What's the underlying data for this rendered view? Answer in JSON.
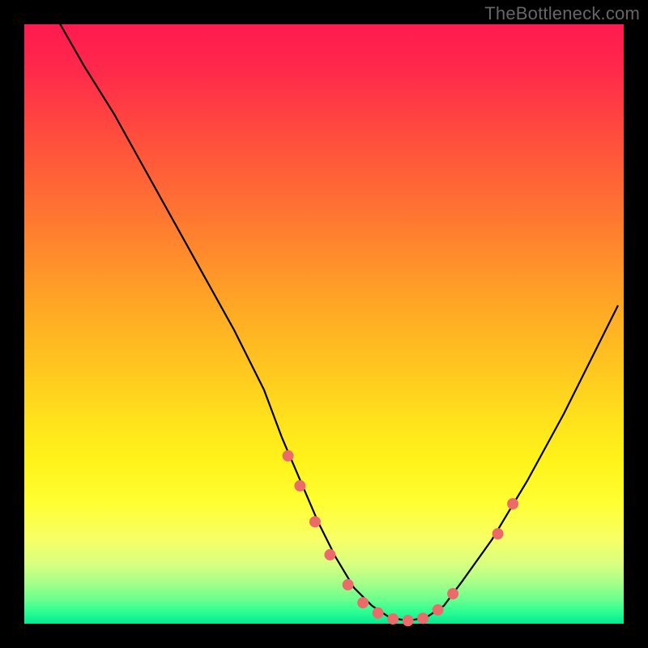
{
  "watermark": "TheBottleneck.com",
  "chart_data": {
    "type": "line",
    "title": "",
    "xlabel": "",
    "ylabel": "",
    "xlim": [
      0,
      100
    ],
    "ylim": [
      0,
      100
    ],
    "series": [
      {
        "name": "curve",
        "x": [
          6,
          10,
          15,
          20,
          25,
          30,
          35,
          40,
          43,
          46,
          49,
          52,
          55,
          58,
          61,
          64,
          67,
          70,
          73,
          78,
          84,
          90,
          95,
          99
        ],
        "y": [
          100,
          93,
          85,
          76,
          67,
          58,
          49,
          39,
          31,
          24,
          17,
          11,
          6,
          3,
          1,
          0.5,
          1,
          3,
          7,
          14,
          24,
          35,
          45,
          53
        ]
      }
    ],
    "markers": {
      "name": "highlighted-points",
      "color": "#ec6a6a",
      "x": [
        44,
        46,
        48.5,
        51,
        54,
        56.5,
        59,
        61.5,
        64,
        66.5,
        69,
        71.5,
        79,
        81.5
      ],
      "y": [
        28,
        23,
        17,
        11.5,
        6.5,
        3.5,
        1.8,
        0.8,
        0.5,
        0.9,
        2.3,
        5,
        15,
        20
      ]
    }
  }
}
